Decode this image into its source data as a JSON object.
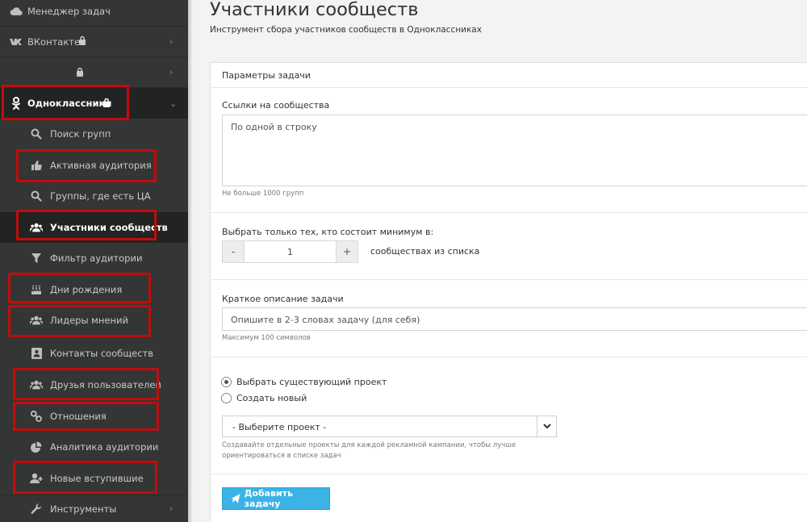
{
  "sidebar": {
    "items": [
      {
        "label": "Менеджер задач",
        "icon": "cloud-icon"
      },
      {
        "label": "ВКонтакте",
        "icon": "vk-icon",
        "locked": true,
        "chevron": "›"
      },
      {
        "label": "",
        "icon": "lock-icon",
        "chevron": "›"
      },
      {
        "label": "Одноклассники",
        "icon": "ok-icon",
        "locked": true,
        "chevron": "⌄"
      },
      {
        "label": "Поиск групп",
        "icon": "search-icon"
      },
      {
        "label": "Активная аудитория",
        "icon": "thumbs-up-icon"
      },
      {
        "label": "Группы, где есть ЦА",
        "icon": "search-icon"
      },
      {
        "label": "Участники сообществ",
        "icon": "users-icon"
      },
      {
        "label": "Фильтр аудитории",
        "icon": "filter-icon"
      },
      {
        "label": "Дни рождения",
        "icon": "birthday-cake-icon"
      },
      {
        "label": "Лидеры мнений",
        "icon": "users-icon"
      },
      {
        "label": "Контакты сообществ",
        "icon": "address-book-icon"
      },
      {
        "label": "Друзья пользователей",
        "icon": "users-icon"
      },
      {
        "label": "Отношения",
        "icon": "link-icon"
      },
      {
        "label": "Аналитика аудитории",
        "icon": "pie-chart-icon"
      },
      {
        "label": "Новые вступившие",
        "icon": "user-plus-icon"
      },
      {
        "label": "Инструменты",
        "icon": "wrench-icon",
        "chevron": "›"
      }
    ]
  },
  "page": {
    "title": "Участники сообществ",
    "subtitle": "Инструмент сбора участников сообществ в Одноклассниках"
  },
  "panel": {
    "heading": "Параметры задачи",
    "links": {
      "label": "Ссылки на сообщества",
      "placeholder": "По одной в строку",
      "help": "Не больше 1000 групп"
    },
    "min_membership": {
      "label": "Выбрать только тех, кто состоит минимум в:",
      "minus": "-",
      "value": "1",
      "plus": "+",
      "suffix": "сообществах из списка"
    },
    "description": {
      "label": "Краткое описание задачи",
      "placeholder": "Опишите в 2-3 словах задачу (для себя)",
      "help": "Максимум 100 символов"
    },
    "project": {
      "option_existing": "Выбрать существующий проект",
      "option_new": "Создать новый",
      "selected": "existing",
      "select_value": "- Выберите проект -",
      "help_line1": "Создавайте отдельные проекты для каждой рекламной кампании, чтобы лучше",
      "help_line2": "ориентироваться в списке задач"
    },
    "submit_label": "Добавить задачу"
  },
  "colors": {
    "sidebar_bg": "#343535",
    "highlight": "#c00d0d",
    "button": "#3bb3e6"
  }
}
